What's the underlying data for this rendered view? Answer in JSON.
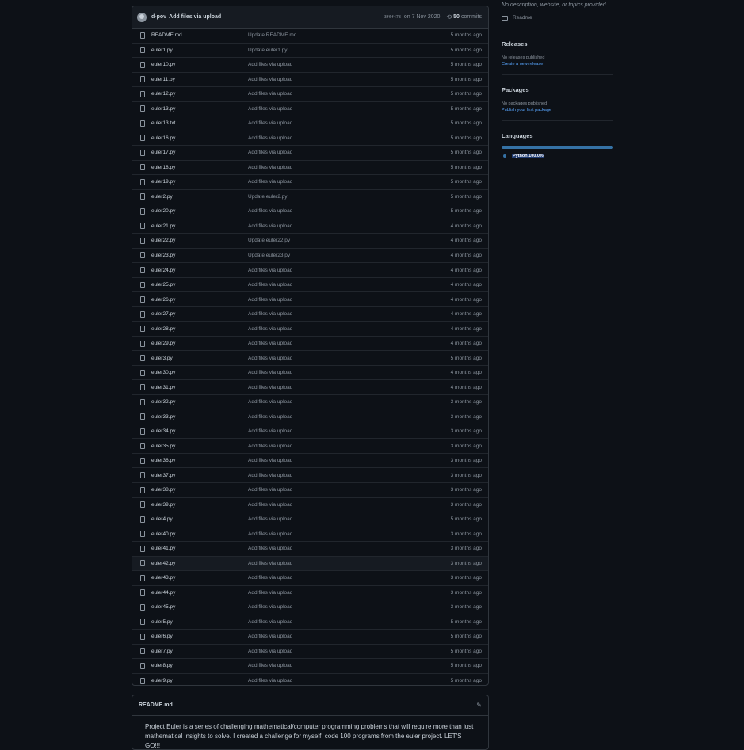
{
  "commit": {
    "author": "d-pov",
    "message": "Add files via upload",
    "sha": "3f6f478",
    "date": "on 7 Nov 2020",
    "commits_count": "50",
    "commits_label": "commits"
  },
  "files": [
    {
      "name": "README.md",
      "message": "Update README.md",
      "age": "5 months ago"
    },
    {
      "name": "euler1.py",
      "message": "Update euler1.py",
      "age": "5 months ago"
    },
    {
      "name": "euler10.py",
      "message": "Add files via upload",
      "age": "5 months ago"
    },
    {
      "name": "euler11.py",
      "message": "Add files via upload",
      "age": "5 months ago"
    },
    {
      "name": "euler12.py",
      "message": "Add files via upload",
      "age": "5 months ago"
    },
    {
      "name": "euler13.py",
      "message": "Add files via upload",
      "age": "5 months ago"
    },
    {
      "name": "euler13.txt",
      "message": "Add files via upload",
      "age": "5 months ago"
    },
    {
      "name": "euler16.py",
      "message": "Add files via upload",
      "age": "5 months ago"
    },
    {
      "name": "euler17.py",
      "message": "Add files via upload",
      "age": "5 months ago"
    },
    {
      "name": "euler18.py",
      "message": "Add files via upload",
      "age": "5 months ago"
    },
    {
      "name": "euler19.py",
      "message": "Add files via upload",
      "age": "5 months ago"
    },
    {
      "name": "euler2.py",
      "message": "Update euler2.py",
      "age": "5 months ago"
    },
    {
      "name": "euler20.py",
      "message": "Add files via upload",
      "age": "5 months ago"
    },
    {
      "name": "euler21.py",
      "message": "Add files via upload",
      "age": "4 months ago"
    },
    {
      "name": "euler22.py",
      "message": "Update euler22.py",
      "age": "4 months ago"
    },
    {
      "name": "euler23.py",
      "message": "Update euler23.py",
      "age": "4 months ago"
    },
    {
      "name": "euler24.py",
      "message": "Add files via upload",
      "age": "4 months ago"
    },
    {
      "name": "euler25.py",
      "message": "Add files via upload",
      "age": "4 months ago"
    },
    {
      "name": "euler26.py",
      "message": "Add files via upload",
      "age": "4 months ago"
    },
    {
      "name": "euler27.py",
      "message": "Add files via upload",
      "age": "4 months ago"
    },
    {
      "name": "euler28.py",
      "message": "Add files via upload",
      "age": "4 months ago"
    },
    {
      "name": "euler29.py",
      "message": "Add files via upload",
      "age": "4 months ago"
    },
    {
      "name": "euler3.py",
      "message": "Add files via upload",
      "age": "5 months ago"
    },
    {
      "name": "euler30.py",
      "message": "Add files via upload",
      "age": "4 months ago"
    },
    {
      "name": "euler31.py",
      "message": "Add files via upload",
      "age": "4 months ago"
    },
    {
      "name": "euler32.py",
      "message": "Add files via upload",
      "age": "3 months ago"
    },
    {
      "name": "euler33.py",
      "message": "Add files via upload",
      "age": "3 months ago"
    },
    {
      "name": "euler34.py",
      "message": "Add files via upload",
      "age": "3 months ago"
    },
    {
      "name": "euler35.py",
      "message": "Add files via upload",
      "age": "3 months ago"
    },
    {
      "name": "euler36.py",
      "message": "Add files via upload",
      "age": "3 months ago"
    },
    {
      "name": "euler37.py",
      "message": "Add files via upload",
      "age": "3 months ago"
    },
    {
      "name": "euler38.py",
      "message": "Add files via upload",
      "age": "3 months ago"
    },
    {
      "name": "euler39.py",
      "message": "Add files via upload",
      "age": "3 months ago"
    },
    {
      "name": "euler4.py",
      "message": "Add files via upload",
      "age": "5 months ago"
    },
    {
      "name": "euler40.py",
      "message": "Add files via upload",
      "age": "3 months ago"
    },
    {
      "name": "euler41.py",
      "message": "Add files via upload",
      "age": "3 months ago"
    },
    {
      "name": "euler42.py",
      "message": "Add files via upload",
      "age": "3 months ago"
    },
    {
      "name": "euler43.py",
      "message": "Add files via upload",
      "age": "3 months ago"
    },
    {
      "name": "euler44.py",
      "message": "Add files via upload",
      "age": "3 months ago"
    },
    {
      "name": "euler45.py",
      "message": "Add files via upload",
      "age": "3 months ago"
    },
    {
      "name": "euler5.py",
      "message": "Add files via upload",
      "age": "5 months ago"
    },
    {
      "name": "euler6.py",
      "message": "Add files via upload",
      "age": "5 months ago"
    },
    {
      "name": "euler7.py",
      "message": "Add files via upload",
      "age": "5 months ago"
    },
    {
      "name": "euler8.py",
      "message": "Add files via upload",
      "age": "5 months ago"
    },
    {
      "name": "euler9.py",
      "message": "Add files via upload",
      "age": "5 months ago"
    }
  ],
  "readme": {
    "title": "README.md",
    "body": "Project Euler is a series of challenging mathematical/computer programming problems that will require more than just mathematical insights to solve. I created a challenge for myself, code 100 programs from the euler project. LET'S GO!!!"
  },
  "sidebar": {
    "about": "No description, website, or topics provided.",
    "readme_label": "Readme",
    "releases": {
      "title": "Releases",
      "note": "No releases published",
      "link": "Create a new release"
    },
    "packages": {
      "title": "Packages",
      "note": "No packages published",
      "link": "Publish your first package"
    },
    "languages": {
      "title": "Languages",
      "items": [
        {
          "name": "Python",
          "percent": "100.0%",
          "color": "#3572A5"
        }
      ]
    }
  },
  "icons": {
    "file": "file-icon",
    "history": "history-icon",
    "edit": "pencil-icon",
    "book": "book-icon"
  }
}
